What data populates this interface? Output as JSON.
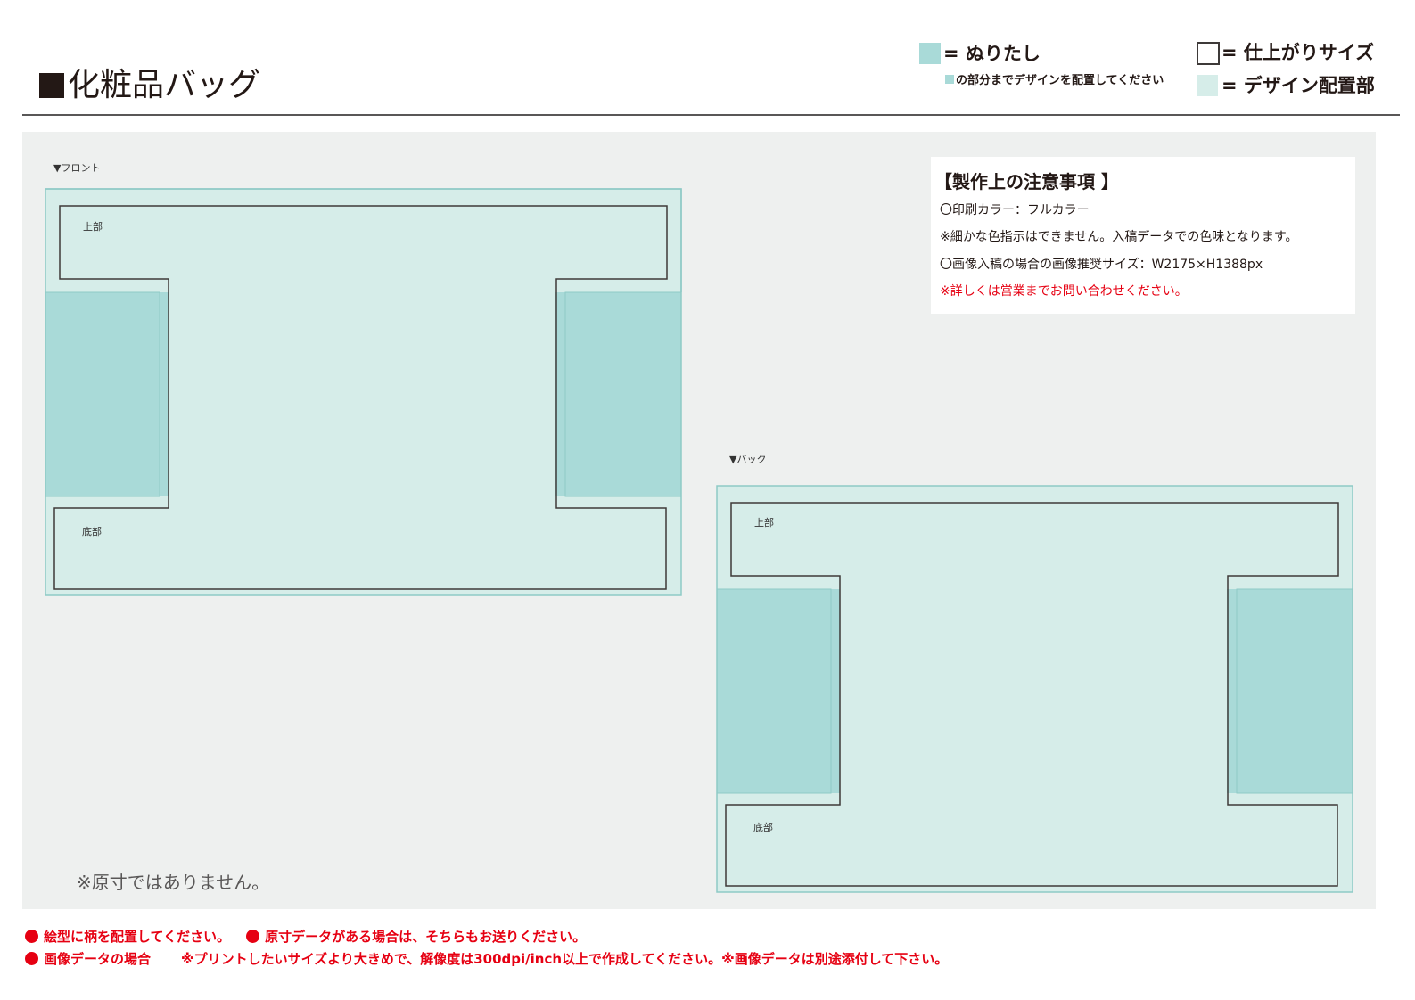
{
  "header": {
    "title": "化粧品バッグ"
  },
  "legend": {
    "bleed_label": "= ぬりたし",
    "bleed_note": "の部分までデザインを配置してください",
    "finish_label": "= 仕上がりサイズ",
    "design_label": "= デザイン配置部",
    "colors": {
      "bleed": "#a9dad8",
      "design": "#d6ede9",
      "outline": "#3e3a39"
    }
  },
  "panels": {
    "front": {
      "label": "▼フロント",
      "top_label": "上部",
      "bottom_label": "底部"
    },
    "back": {
      "label": "▼バック",
      "top_label": "上部",
      "bottom_label": "底部"
    }
  },
  "notes": {
    "heading": "【製作上の注意事項 】",
    "lines": [
      "〇印刷カラー：フルカラー",
      "※細かな色指示はできません。入稿データでの色味となります。",
      "〇画像入稿の場合の画像推奨サイズ：W2175×H1388px",
      "※詳しくは営業までお問い合わせください。"
    ]
  },
  "disclaimer": "※原寸ではありません。",
  "footer": {
    "line1_a": "絵型に柄を配置してください。",
    "line1_b": "原寸データがある場合は、そちらもお送りください。",
    "line2_a": "画像データの場合",
    "line2_b": "※プリントしたいサイズより大きめで、解像度は300dpi/inch以上で作成してください。※画像データは別途添付して下さい。"
  }
}
